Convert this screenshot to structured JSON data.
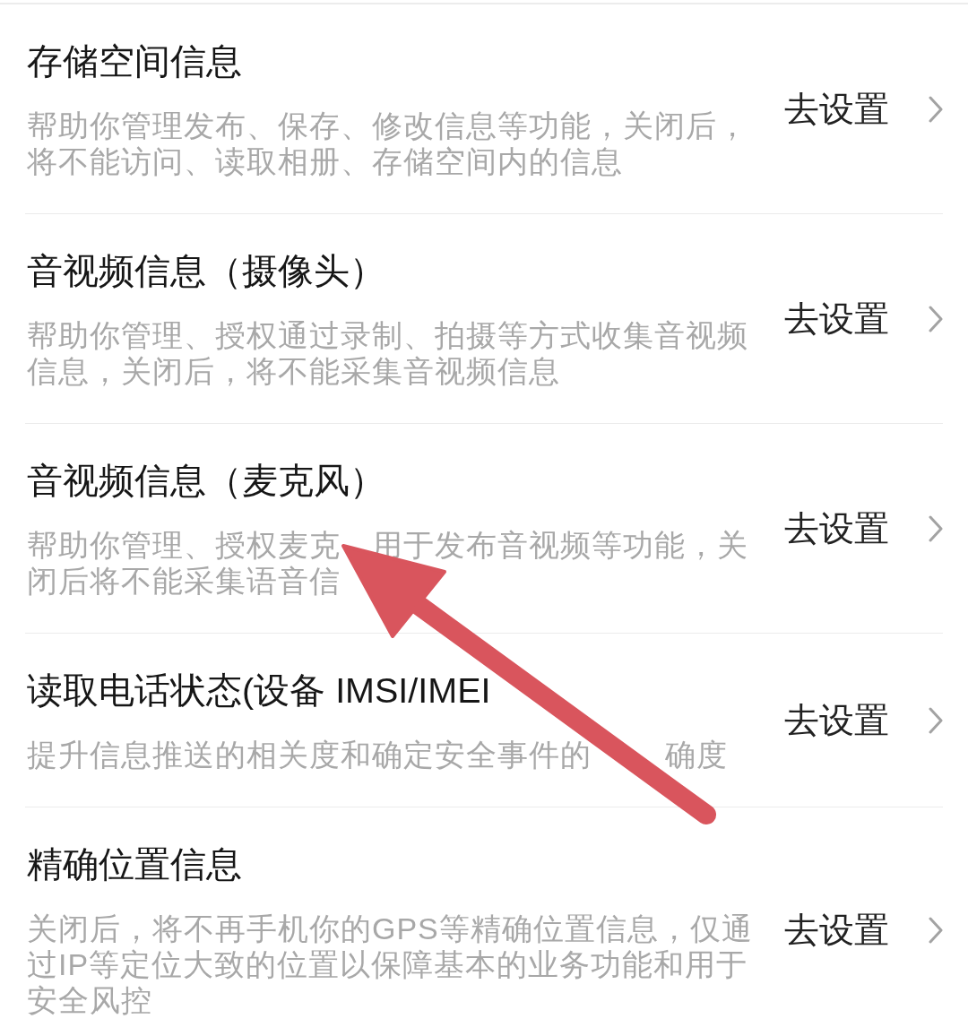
{
  "settings": [
    {
      "title": "存储空间信息",
      "description": [
        "帮助你管理发布、保存、修改信息等功能，关闭后，将不能访问、读取相册、存储空间内的信息"
      ],
      "action": "去设置"
    },
    {
      "title": "音视频信息（摄像头）",
      "description": [
        "帮助你管理、授权通过录制、拍摄等方式收集音视频信息，关闭后，将不能采集音视频信息"
      ],
      "action": "去设置"
    },
    {
      "title": "音视频信息（麦克风）",
      "description": [
        "帮助你管理、授权麦克",
        "用于发布音视频等功能，关闭后将不能采集语音信"
      ],
      "action": "去设置"
    },
    {
      "title": "读取电话状态(设备 IMSI/IMEI",
      "description": [
        "提升信息推送的相关度和确定安全事件的",
        "确度"
      ],
      "action": "去设置"
    },
    {
      "title": "精确位置信息",
      "description": [
        "关闭后，将不再手机你的GPS等精确位置信息，仅通过IP等定位大致的位置以保障基本的业务功能和用于安全风控"
      ],
      "action": "去设置"
    }
  ],
  "annotation": {
    "kind": "arrow"
  }
}
